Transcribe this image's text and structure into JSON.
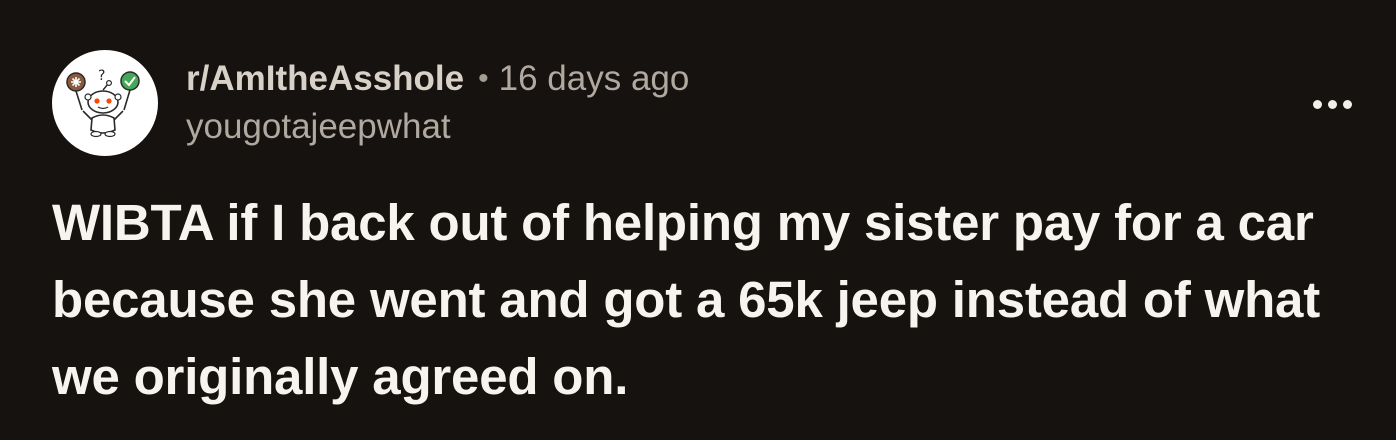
{
  "post": {
    "subreddit": "r/AmItheAsshole",
    "separator": "•",
    "time_ago": "16 days ago",
    "username": "yougotajeepwhat",
    "title": "WIBTA if I back out of helping my sister pay for a car because she went and got a 65k jeep instead of what we originally agreed on."
  },
  "icons": {
    "avatar": "reddit-snoo-aita-icon",
    "more": "more-options-icon"
  },
  "colors": {
    "background": "#16120f",
    "title_text": "#f7f4ef",
    "meta_text": "#b0a9a0",
    "subreddit_text": "#d8d1c8",
    "avatar_bg": "#ffffff",
    "reddit_red": "#ff4500",
    "check_green": "#46a758",
    "sign_brown": "#8a5a3c"
  }
}
